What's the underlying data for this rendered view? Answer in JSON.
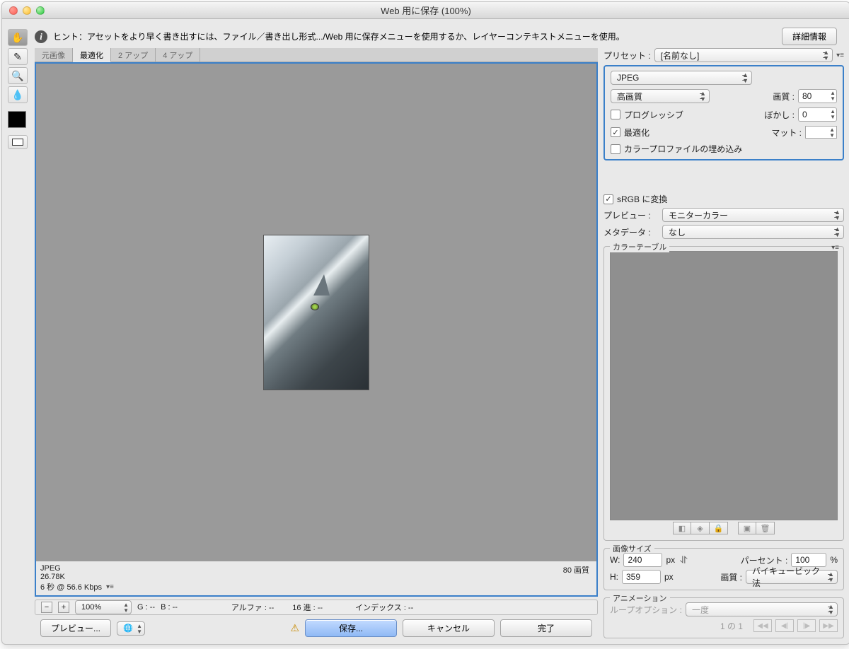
{
  "title": "Web 用に保存 (100%)",
  "hint": "ヒント：アセットをより早く書き出すには、ファイル／書き出し形式.../Web 用に保存メニューを使用するか、レイヤーコンテキストメニューを使用。",
  "details_btn": "詳細情報",
  "tabs": {
    "t1": "元画像",
    "t2": "最適化",
    "t3": "2 アップ",
    "t4": "4 アップ"
  },
  "canvas_info": {
    "format": "JPEG",
    "size": "26.78K",
    "speed": "6 秒 @ 56.6 Kbps",
    "quality_right": "80 画質"
  },
  "preset": {
    "label": "プリセット :",
    "value": "[名前なし]"
  },
  "format": {
    "value": "JPEG"
  },
  "quality_preset": {
    "value": "高画質"
  },
  "quality": {
    "label": "画質 :",
    "value": "80"
  },
  "progressive": "プログレッシブ",
  "blur": {
    "label": "ぼかし :",
    "value": "0"
  },
  "optimized": "最適化",
  "matte": "マット :",
  "embed_profile": "カラープロファイルの埋め込み",
  "srgb": "sRGB に変換",
  "preview": {
    "label": "プレビュー :",
    "value": "モニターカラー"
  },
  "metadata": {
    "label": "メタデータ :",
    "value": "なし"
  },
  "colortable": "カラーテーブル",
  "imagesize": {
    "title": "画像サイズ",
    "w_lbl": "W:",
    "w": "240",
    "h_lbl": "H:",
    "h": "359",
    "px": "px",
    "percent_lbl": "パーセント :",
    "percent": "100",
    "pct": "%",
    "quality_lbl": "画質 :",
    "quality_sel": "バイキュービック法"
  },
  "animation": {
    "title": "アニメーション",
    "loop_lbl": "ループオプション :",
    "loop_val": "一度",
    "counter": "1 の 1"
  },
  "status": {
    "zoom": "100%",
    "g": "G : --",
    "b": "B : --",
    "alpha": "アルファ : --",
    "hex": "16 進 : --",
    "index": "インデックス : --"
  },
  "footer": {
    "preview_btn": "プレビュー...",
    "save": "保存...",
    "cancel": "キャンセル",
    "done": "完了"
  }
}
